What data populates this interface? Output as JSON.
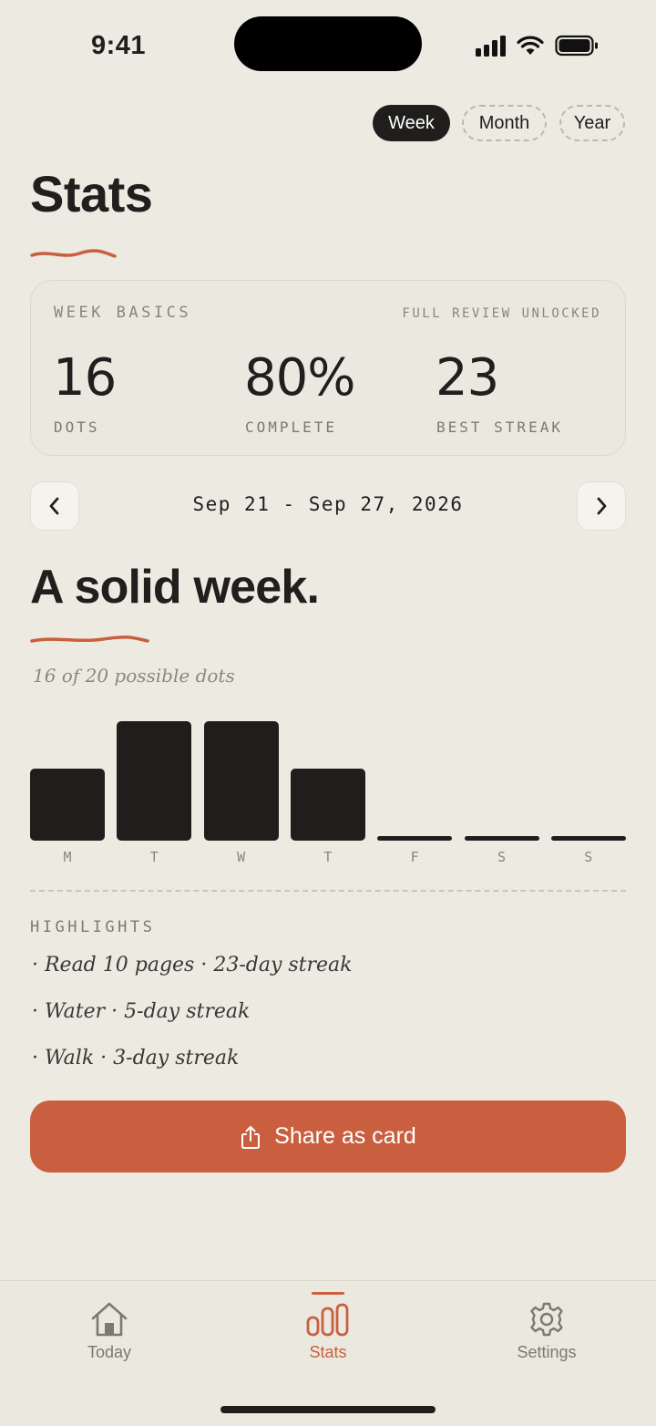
{
  "status_bar": {
    "time": "9:41"
  },
  "period_tabs": [
    {
      "label": "Week",
      "active": true
    },
    {
      "label": "Month",
      "active": false
    },
    {
      "label": "Year",
      "active": false
    }
  ],
  "page_title": "Stats",
  "basics": {
    "label": "WEEK BASICS",
    "unlock_note": "FULL REVIEW UNLOCKED",
    "stats": [
      {
        "value": "16",
        "label": "DOTS"
      },
      {
        "value": "80%",
        "label": "COMPLETE"
      },
      {
        "value": "23",
        "label": "BEST STREAK"
      }
    ]
  },
  "date_range": "Sep 21 - Sep 27, 2026",
  "headline": "A solid week.",
  "subline": "16 of 20 possible dots",
  "chart_data": {
    "type": "bar",
    "categories": [
      "M",
      "T",
      "W",
      "T",
      "F",
      "S",
      "S"
    ],
    "values": [
      3,
      5,
      5,
      3,
      0,
      0,
      0
    ],
    "ylim": [
      0,
      5
    ]
  },
  "highlights": {
    "title": "HIGHLIGHTS",
    "items": [
      "· Read 10 pages · 23-day streak",
      "· Water · 5-day streak",
      "· Walk · 3-day streak"
    ]
  },
  "share_button": {
    "label": "Share as card",
    "icon": "share-icon"
  },
  "tab_bar": [
    {
      "label": "Today",
      "icon": "home-icon",
      "active": false
    },
    {
      "label": "Stats",
      "icon": "bar-chart-icon",
      "active": true
    },
    {
      "label": "Settings",
      "icon": "gear-icon",
      "active": false
    }
  ],
  "colors": {
    "accent": "#c95f3f",
    "ink": "#1f1e1c",
    "background": "#edeae2"
  }
}
